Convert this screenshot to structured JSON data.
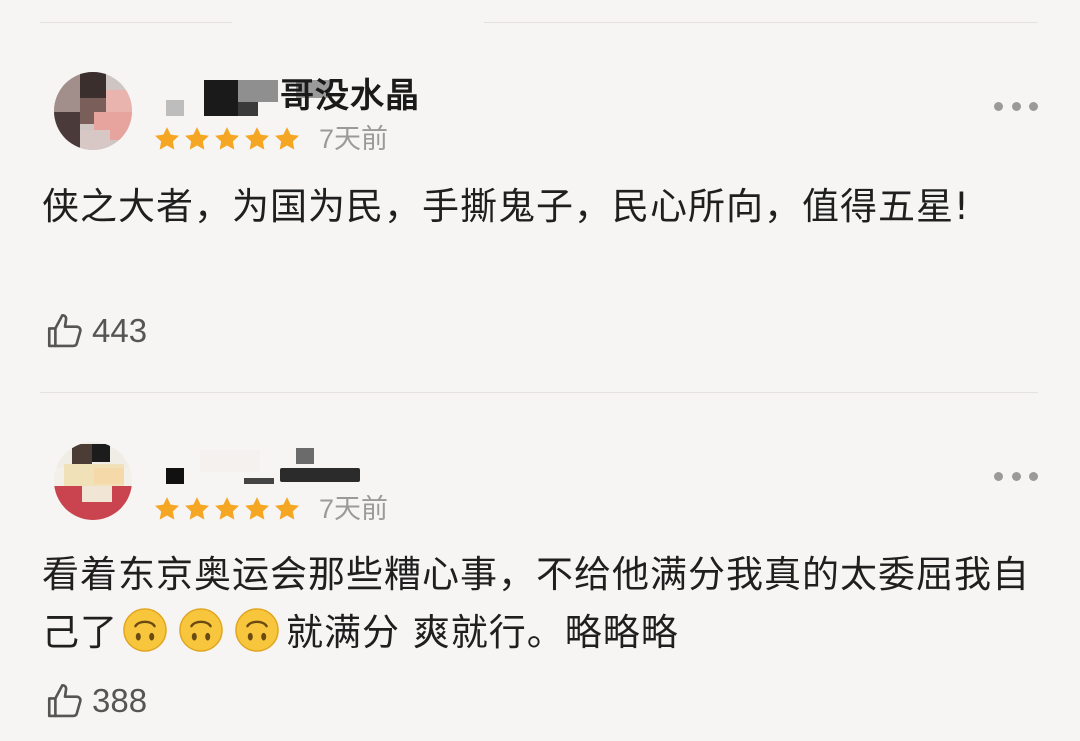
{
  "colors": {
    "background": "#f7f5f4",
    "star": "#f5a623",
    "time_text": "#9a9a9a",
    "divider": "#e4e1df"
  },
  "reviews": [
    {
      "username_visible": "哥没水晶",
      "rating": 5,
      "max_rating": 5,
      "time": "7天前",
      "content": "侠之大者，为国为民，手撕鬼子，民心所向，值得五星!",
      "likes": "443",
      "icons": [
        "avatar",
        "star-icon",
        "more-icon",
        "thumbs-up-icon"
      ]
    },
    {
      "username_visible": "",
      "rating": 5,
      "max_rating": 5,
      "time": "7天前",
      "content_before": "看着东京奥运会那些糟心事，不给他满分我真的太委屈我自己了",
      "content_after": "就满分 爽就行。略略略",
      "emoji_count": 3,
      "emoji_icon": "upside-down-face-emoji",
      "likes": "388",
      "icons": [
        "avatar",
        "star-icon",
        "more-icon",
        "thumbs-up-icon"
      ]
    }
  ]
}
